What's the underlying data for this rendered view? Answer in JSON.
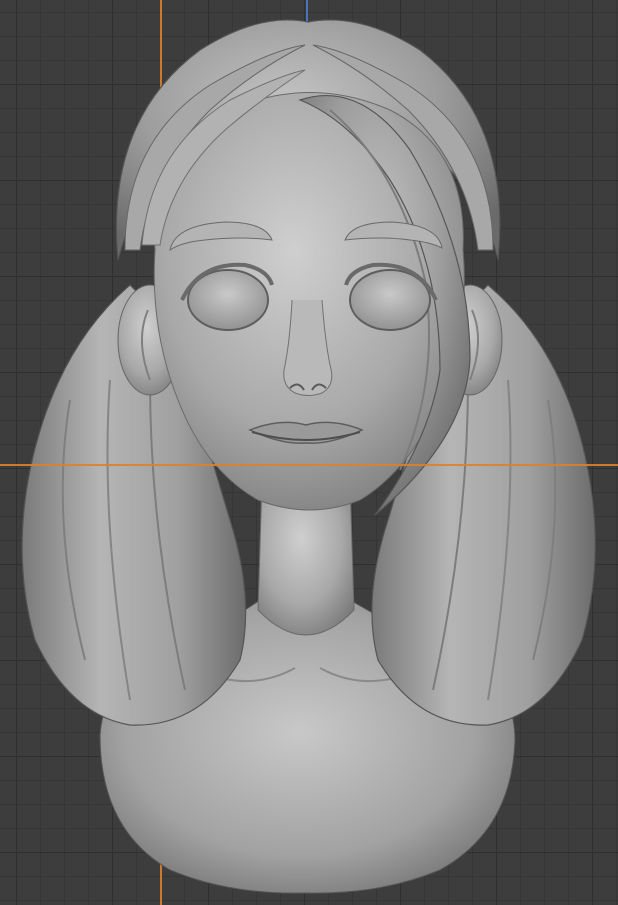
{
  "viewport": {
    "title": "",
    "grid": true,
    "colors": {
      "background": "#3d3d3d",
      "grid_major": "#2f2f2f",
      "grid_minor": "#363636",
      "x_axis": "#d9822b",
      "y_axis": "#d9822b",
      "z_axis": "#4a78c8",
      "clay": "#9c9c9c"
    }
  },
  "model": {
    "subject": "clay-sculpt-bust",
    "material": "matcap-grey"
  }
}
